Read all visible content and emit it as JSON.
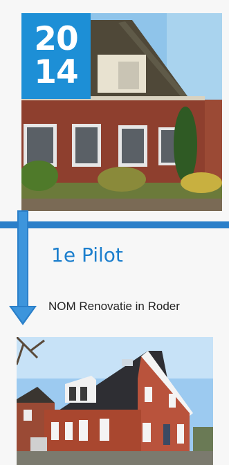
{
  "timeline": {
    "year_top": "20",
    "year_bottom": "14",
    "pilot_title": "1e Pilot",
    "pilot_description": "NOM Renovatie in Roder"
  },
  "colors": {
    "accent": "#1d8fd6",
    "bar": "#2a7fc9",
    "title": "#1d7fcd"
  }
}
